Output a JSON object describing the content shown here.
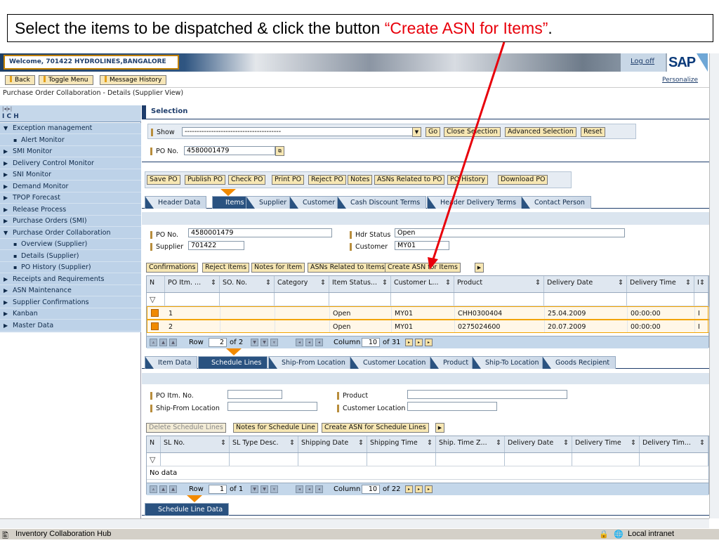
{
  "annotation": {
    "prefix": "Select the items to be dispatched & click the button ",
    "highlight": "“Create ASN for Items”",
    "suffix": "."
  },
  "header": {
    "welcome": "Welcome, 701422   HYDROLINES,BANGALORE",
    "logoff": "Log off",
    "logo": "SAP"
  },
  "top_buttons": [
    "Back",
    "Toggle Menu",
    "Message History"
  ],
  "personalize": "Personalize",
  "breadcrumb": "Purchase Order Collaboration - Details (Supplier View)",
  "nav": {
    "title": "I C H",
    "items": [
      {
        "label": "Exception management",
        "open": true,
        "level": 0
      },
      {
        "label": "Alert Monitor",
        "level": 1
      },
      {
        "label": "SMI Monitor",
        "level": 0
      },
      {
        "label": "Delivery Control Monitor",
        "level": 0
      },
      {
        "label": "SNI Monitor",
        "level": 0
      },
      {
        "label": "Demand Monitor",
        "level": 0
      },
      {
        "label": "TPOP Forecast",
        "level": 0
      },
      {
        "label": "Release Process",
        "level": 0
      },
      {
        "label": "Purchase Orders (SMI)",
        "level": 0
      },
      {
        "label": "Purchase Order Collaboration",
        "open": true,
        "level": 0
      },
      {
        "label": "Overview (Supplier)",
        "level": 1
      },
      {
        "label": "Details (Supplier)",
        "level": 1
      },
      {
        "label": "PO History (Supplier)",
        "level": 1
      },
      {
        "label": "Receipts and Requirements",
        "level": 0
      },
      {
        "label": "ASN Maintenance",
        "level": 0
      },
      {
        "label": "Supplier Confirmations",
        "level": 0
      },
      {
        "label": "Kanban",
        "level": 0
      },
      {
        "label": "Master Data",
        "level": 0
      }
    ]
  },
  "selection": {
    "title": "Selection",
    "show_label": "Show",
    "show_value": "----------------------------------------",
    "buttons": [
      "Go",
      "Close Selection",
      "Advanced Selection",
      "Reset"
    ],
    "po_label": "PO No.",
    "po_value": "4580001479"
  },
  "po_actions": [
    "Save PO",
    "Publish PO",
    "Check PO",
    "Print PO",
    "Reject PO",
    "Notes",
    "ASNs Related to PO",
    "PO History",
    "Download PO"
  ],
  "tabs1": [
    "Header Data",
    "Items",
    "Supplier",
    "Customer",
    "Cash Discount Terms",
    "Header Delivery Terms",
    "Contact Person"
  ],
  "header_fields": {
    "po_label": "PO No.",
    "po_value": "4580001479",
    "supplier_label": "Supplier",
    "supplier_value": "701422",
    "status_label": "Hdr Status",
    "status_value": "Open",
    "customer_label": "Customer",
    "customer_value": "MY01"
  },
  "item_actions": [
    "Confirmations",
    "Reject Items",
    "Notes for Item",
    "ASNs Related to Items",
    "Create ASN for Items"
  ],
  "items_table": {
    "columns": [
      "N",
      "PO Itm. ...",
      "SO. No.",
      "Category",
      "Item Status...",
      "Customer L...",
      "Product",
      "Delivery Date",
      "Delivery Time",
      "I"
    ],
    "rows": [
      [
        "1",
        "",
        "",
        "Open",
        "MY01",
        "CHH0300404",
        "25.04.2009",
        "00:00:00",
        "I"
      ],
      [
        "2",
        "",
        "",
        "Open",
        "MY01",
        "0275024600",
        "20.07.2009",
        "00:00:00",
        "I"
      ]
    ],
    "pager": {
      "row_label": "Row",
      "row": "2",
      "of_rows": "of 2",
      "col_label": "Column",
      "col": "10",
      "of_cols": "of 31"
    }
  },
  "tabs2": [
    "Item Data",
    "Schedule Lines",
    "Ship-From Location",
    "Customer Location",
    "Product",
    "Ship-To Location",
    "Goods Recipient"
  ],
  "item_fields": {
    "po_itm_label": "PO Itm. No.",
    "ship_from_label": "Ship-From Location",
    "product_label": "Product",
    "cust_loc_label": "Customer Location"
  },
  "sched_actions": [
    "Delete Schedule Lines",
    "Notes for Schedule Line",
    "Create ASN for Schedule Lines"
  ],
  "sched_table": {
    "columns": [
      "N",
      "SL No.",
      "SL Type Desc.",
      "Shipping Date",
      "Shipping Time",
      "Ship. Time Z...",
      "Delivery Date",
      "Delivery Time",
      "Delivery Tim..."
    ],
    "empty": "No data",
    "pager": {
      "row_label": "Row",
      "row": "1",
      "of_rows": "of 1",
      "col_label": "Column",
      "col": "10",
      "of_cols": "of 22"
    }
  },
  "tabs3": [
    "Schedule Line Data"
  ],
  "statusbar": {
    "left": "Inventory Collaboration Hub",
    "right": "Local intranet"
  }
}
